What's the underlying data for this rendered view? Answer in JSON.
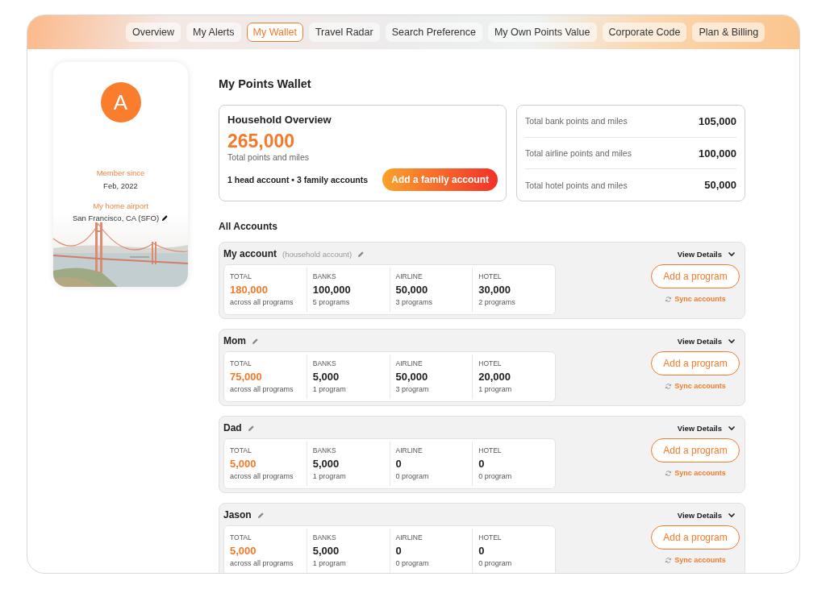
{
  "tabs": [
    {
      "label": "Overview",
      "selected": false
    },
    {
      "label": "My Alerts",
      "selected": false
    },
    {
      "label": "My Wallet",
      "selected": true
    },
    {
      "label": "Travel Radar",
      "selected": false
    },
    {
      "label": "Search Preference",
      "selected": false
    },
    {
      "label": "My Own Points Value",
      "selected": false
    },
    {
      "label": "Corporate Code",
      "selected": false
    },
    {
      "label": "Plan & Billing",
      "selected": false
    }
  ],
  "profile": {
    "avatar_letter": "A",
    "member_since_label": "Member since",
    "member_since": "Feb, 2022",
    "home_airport_label": "My home airport",
    "home_airport": "San Francisco, CA (SFO)"
  },
  "title": "My Points Wallet",
  "household": {
    "title": "Household Overview",
    "total": "265,000",
    "total_label": "Total points and miles",
    "summary": "1 head account • 3 family accounts",
    "button": "Add a family account"
  },
  "totals": [
    {
      "label": "Total bank points and miles",
      "value": "105,000"
    },
    {
      "label": "Total airline points and miles",
      "value": "100,000"
    },
    {
      "label": "Total hotel points and miles",
      "value": "50,000"
    }
  ],
  "accounts_heading": "All Accounts",
  "accounts": [
    {
      "name": "My account",
      "note": "(household account)",
      "view_details": "View Details",
      "add_button": "Add a program",
      "sync": "Sync accounts",
      "stats": [
        {
          "label": "TOTAL",
          "value": "180,000",
          "sub": "across all programs"
        },
        {
          "label": "BANKS",
          "value": "100,000",
          "sub": "5 programs"
        },
        {
          "label": "AIRLINE",
          "value": "50,000",
          "sub": "3 programs"
        },
        {
          "label": "HOTEL",
          "value": "30,000",
          "sub": "2 programs"
        }
      ]
    },
    {
      "name": "Mom",
      "view_details": "View Details",
      "add_button": "Add a program",
      "sync": "Sync accounts",
      "stats": [
        {
          "label": "TOTAL",
          "value": "75,000",
          "sub": "across all programs"
        },
        {
          "label": "BANKS",
          "value": "5,000",
          "sub": "1 program"
        },
        {
          "label": "AIRLINE",
          "value": "50,000",
          "sub": "3 program"
        },
        {
          "label": "HOTEL",
          "value": "20,000",
          "sub": "1 program"
        }
      ]
    },
    {
      "name": "Dad",
      "view_details": "View Details",
      "add_button": "Add a program",
      "sync": "Sync accounts",
      "stats": [
        {
          "label": "TOTAL",
          "value": "5,000",
          "sub": "across all programs"
        },
        {
          "label": "BANKS",
          "value": "5,000",
          "sub": "1 program"
        },
        {
          "label": "AIRLINE",
          "value": "0",
          "sub": "0 program"
        },
        {
          "label": "HOTEL",
          "value": "0",
          "sub": "0 program"
        }
      ]
    },
    {
      "name": "Jason",
      "view_details": "View Details",
      "add_button": "Add a program",
      "sync": "Sync accounts",
      "stats": [
        {
          "label": "TOTAL",
          "value": "5,000",
          "sub": "across all programs"
        },
        {
          "label": "BANKS",
          "value": "5,000",
          "sub": "1 program"
        },
        {
          "label": "AIRLINE",
          "value": "0",
          "sub": "0 program"
        },
        {
          "label": "HOTEL",
          "value": "0",
          "sub": "0 program"
        }
      ]
    }
  ]
}
